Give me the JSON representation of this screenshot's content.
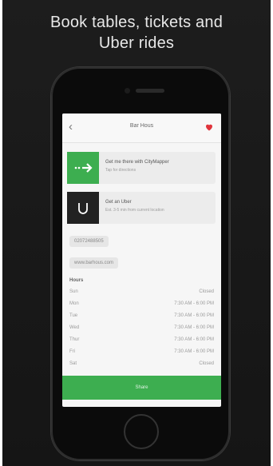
{
  "headline": {
    "line1": "Book tables, tickets and",
    "line2": "Uber rides"
  },
  "screen": {
    "title": "Bar Hous",
    "back_icon": "chevron-left-icon",
    "favorite_icon": "heart-icon",
    "cards": [
      {
        "icon": "arrow-right-icon",
        "title": "Get me there with CityMapper",
        "subtitle": "Tap for directions",
        "color": "#3dae50"
      },
      {
        "icon": "uber-logo-icon",
        "title": "Get an Uber",
        "subtitle": "Est. 3-5 min from current location",
        "color": "#222222"
      }
    ],
    "phone": "02072488505",
    "website": "www.barhous.com",
    "hours_title": "Hours",
    "hours": [
      {
        "day": "Sun",
        "time": "Closed"
      },
      {
        "day": "Mon",
        "time": "7:30 AM - 6:00 PM"
      },
      {
        "day": "Tue",
        "time": "7:30 AM - 6:00 PM"
      },
      {
        "day": "Wed",
        "time": "7:30 AM - 6:00 PM"
      },
      {
        "day": "Thur",
        "time": "7:30 AM - 6:00 PM"
      },
      {
        "day": "Fri",
        "time": "7:30 AM - 6:00 PM"
      },
      {
        "day": "Sat",
        "time": "Closed"
      }
    ],
    "cta": "Share",
    "accent": "#3dae50",
    "heart_color": "#e0343c"
  }
}
